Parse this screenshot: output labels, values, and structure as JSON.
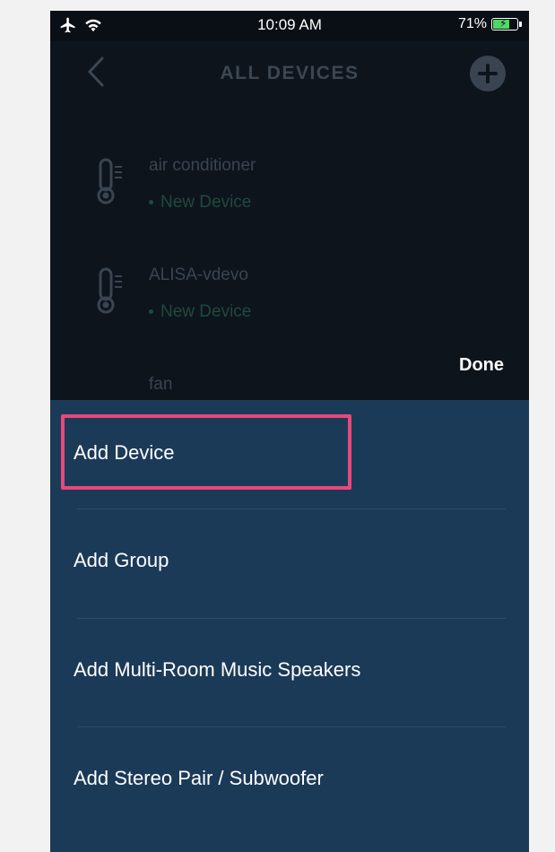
{
  "status_bar": {
    "time": "10:09 AM",
    "battery_percent": "71%",
    "battery_level": 0.71,
    "airplane_icon": "airplane-icon",
    "wifi_icon": "wifi-icon"
  },
  "header": {
    "title": "ALL DEVICES",
    "back_icon": "chevron-left-icon",
    "add_icon": "plus-circle-icon"
  },
  "devices": [
    {
      "name": "air conditioner",
      "status": "New Device",
      "icon": "thermometer-icon"
    },
    {
      "name": "ALISA-vdevo",
      "status": "New Device",
      "icon": "thermometer-icon"
    },
    {
      "name": "fan",
      "status": "",
      "icon": "fan-icon"
    }
  ],
  "done_label": "Done",
  "menu": {
    "items": [
      {
        "label": "Add Device"
      },
      {
        "label": "Add Group"
      },
      {
        "label": "Add Multi-Room Music Speakers"
      },
      {
        "label": "Add Stereo Pair / Subwoofer"
      }
    ]
  },
  "colors": {
    "sheet_background": "#1b3a58",
    "highlight": "#e8497a",
    "status_green": "#4cd964",
    "dark_background": "#0d141c"
  }
}
